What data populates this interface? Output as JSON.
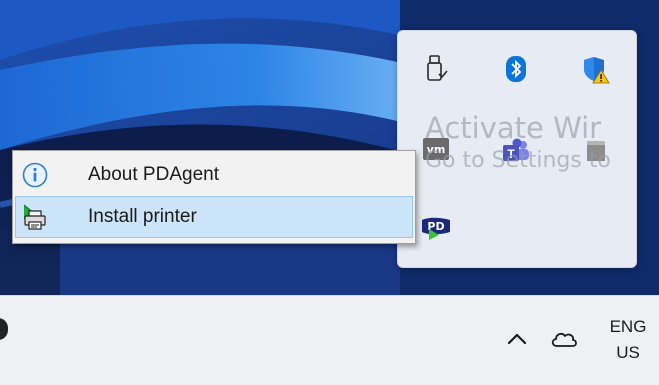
{
  "context_menu": {
    "items": [
      {
        "label": "About PDAgent",
        "icon": "info-icon",
        "highlighted": false
      },
      {
        "label": "Install printer",
        "icon": "printer-install-icon",
        "highlighted": true
      }
    ]
  },
  "tray_flyout": {
    "icons": [
      "usb-device-icon",
      "bluetooth-icon",
      "windows-security-warning-icon",
      "vmware-icon",
      "teams-icon",
      "generic-app-icon",
      "pdagent-icon"
    ]
  },
  "watermark": {
    "line1": "Activate Wir",
    "line2": "Go to Settings to"
  },
  "taskbar": {
    "language_line1": "ENG",
    "language_line2": "US"
  },
  "colors": {
    "menu_background": "#f2f2f2",
    "menu_highlight": "#cce4f7",
    "menu_highlight_border": "#99c8ee",
    "flyout_background": "#e7ebf3",
    "taskbar_background": "#eef0f4",
    "bluetooth_blue": "#0a74d8",
    "info_blue": "#2f7fd6"
  }
}
